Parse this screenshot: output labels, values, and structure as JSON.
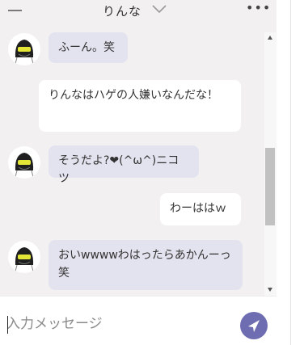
{
  "header": {
    "title": "りんな"
  },
  "messages": [
    {
      "sender": "rinna",
      "text": "ふーん。笑"
    },
    {
      "sender": "user",
      "text": "りんなはハゲの人嫌いなんだな！"
    },
    {
      "sender": "rinna",
      "text": "そうだよ?❤(^ω^)ニコツ"
    },
    {
      "sender": "user",
      "text": "わーははｗ"
    },
    {
      "sender": "rinna",
      "text": "おいwwwwわはったらあかんーっ笑"
    }
  ],
  "composer": {
    "placeholder": "入力メッセージ"
  },
  "colors": {
    "accent": "#6f6db2",
    "incoming_bubble": "#e3e3ef",
    "outgoing_bubble": "#ffffff",
    "background": "#f2f0f0"
  },
  "icons": {
    "minimize": "minimize-icon",
    "title_dropdown": "chevron-down-icon",
    "more": "more-icon",
    "send": "send-icon",
    "avatar": "rinna-avatar"
  }
}
